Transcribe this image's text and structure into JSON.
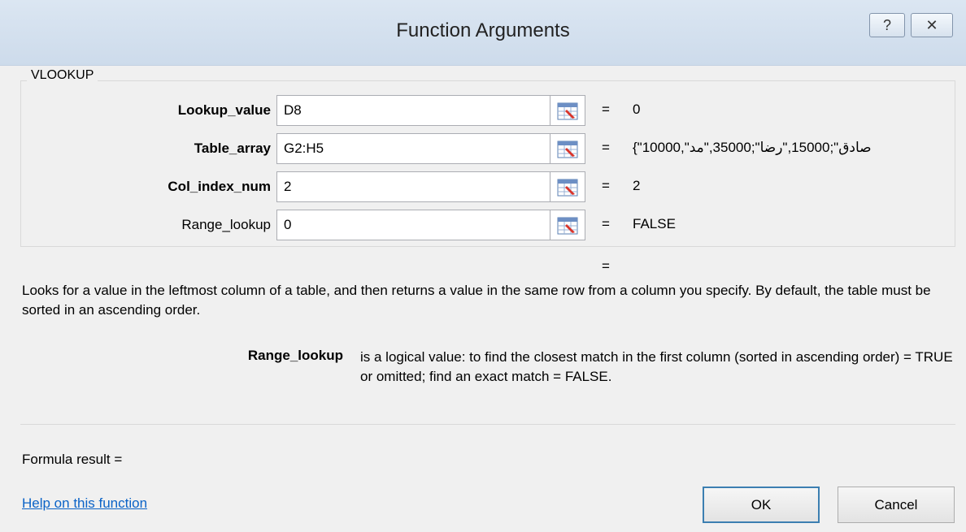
{
  "window": {
    "title": "Function Arguments",
    "help_button": "?",
    "close_button": "✕"
  },
  "function_name": "VLOOKUP",
  "arguments": [
    {
      "label": "Lookup_value",
      "value": "D8",
      "result": "0"
    },
    {
      "label": "Table_array",
      "value": "G2:H5",
      "result": "{\"10000,\"صادق\";15000,\"رضا\";35000,\"مد"
    },
    {
      "label": "Col_index_num",
      "value": "2",
      "result": "2"
    },
    {
      "label": "Range_lookup",
      "value": "0",
      "result": "FALSE"
    }
  ],
  "equals_sign": "=",
  "description": "Looks for a value in the leftmost column of a table, and then returns a value in the same row from a column you specify. By default, the table must be sorted in an ascending order.",
  "parameter_help": {
    "name": "Range_lookup",
    "text": "is a logical value: to find the closest match in the first column (sorted in ascending order) = TRUE or omitted; find an exact match = FALSE."
  },
  "formula_result_label": "Formula result =",
  "help_link": "Help on this function",
  "buttons": {
    "ok": "OK",
    "cancel": "Cancel"
  },
  "colors": {
    "link": "#0b63c7",
    "ok_border": "#3c7fb1",
    "titlebar": "#dbe6f2"
  }
}
